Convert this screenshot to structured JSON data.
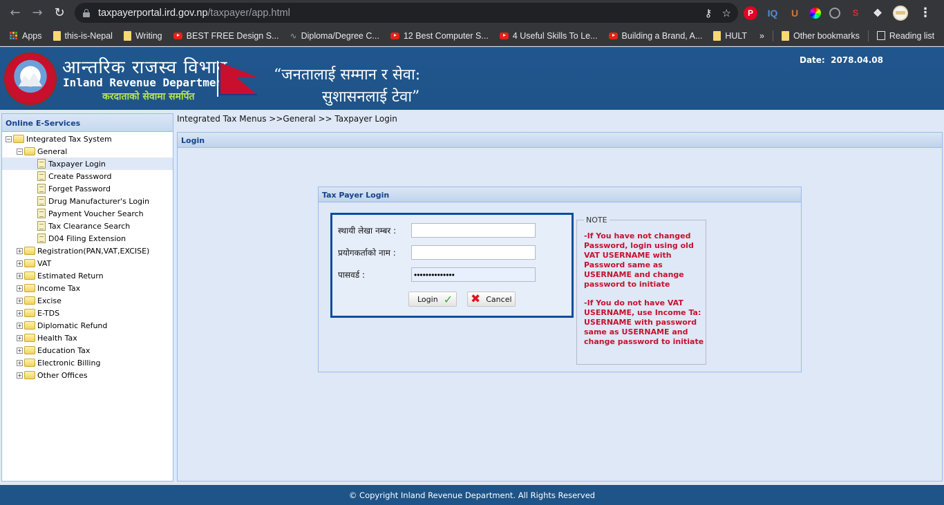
{
  "browser": {
    "url_host": "taxpayerportal.ird.gov.np",
    "url_path": "/taxpayer/app.html",
    "bookmarks": [
      {
        "label": "Apps",
        "icon": "apps-grid"
      },
      {
        "label": "this-is-Nepal",
        "icon": "folder"
      },
      {
        "label": "Writing",
        "icon": "folder"
      },
      {
        "label": "BEST FREE Design S...",
        "icon": "youtube"
      },
      {
        "label": "Diploma/Degree C...",
        "icon": "wave"
      },
      {
        "label": "12 Best Computer S...",
        "icon": "youtube"
      },
      {
        "label": "4 Useful Skills To Le...",
        "icon": "youtube"
      },
      {
        "label": "Building a Brand, A...",
        "icon": "youtube"
      },
      {
        "label": "HULT",
        "icon": "folder"
      }
    ],
    "overflow_label": "»",
    "other_bookmarks": "Other bookmarks",
    "reading_list": "Reading list",
    "extensions": [
      "pinterest",
      "IQ",
      "U",
      "color-picker",
      "clock",
      "seo",
      "extensions-puzzle"
    ]
  },
  "header": {
    "dept_name_np": "आन्तरिक राजस्व विभाग",
    "dept_name_en": "Inland Revenue Department",
    "slogan_np": "करदाताको सेवामा समर्पित",
    "motto_line1": "“जनतालाई सम्मान र सेवा:",
    "motto_line2": "सुशासनलाई टेवा”",
    "date_label": "Date:",
    "date_value": "2078.04.08"
  },
  "sidebar": {
    "title": "Online E-Services",
    "root": "Integrated Tax System",
    "general": "General",
    "general_items": [
      "Taxpayer Login",
      "Create Password",
      "Forget Password",
      "Drug Manufacturer's Login",
      "Payment Voucher Search",
      "Tax Clearance Search",
      "D04 Filing Extension"
    ],
    "collapsed_groups": [
      "Registration(PAN,VAT,EXCISE)",
      "VAT",
      "Estimated Return",
      "Income Tax",
      "Excise",
      "E-TDS",
      "Diplomatic Refund",
      "Health Tax",
      "Education Tax",
      "Electronic Billing",
      "Other Offices"
    ]
  },
  "main": {
    "breadcrumb": "Integrated Tax Menus >>General >> Taxpayer Login",
    "panel_title": "Login",
    "login_box_title": "Tax Payer Login",
    "fields": [
      {
        "label": "स्थायी लेखा नम्बर :",
        "value": "",
        "type": "text"
      },
      {
        "label": "प्रयोगकर्ताको नाम :",
        "value": "",
        "type": "text"
      },
      {
        "label": "पासवर्ड :",
        "value": "••••••••••••••",
        "type": "password"
      }
    ],
    "login_button": "Login",
    "cancel_button": "Cancel",
    "note_title": "NOTE",
    "note_paragraphs": [
      "-If You have not changed Password, login using old VAT USERNAME with Password same as USERNAME and change password to initiate",
      "-If You do not have VAT USERNAME, use Income Ta: USERNAME with password same as USERNAME and change password to initiate"
    ],
    "note_color": "#c4122f"
  },
  "footer": {
    "copyright": "© Copyright Inland Revenue Department. All Rights Reserved"
  }
}
